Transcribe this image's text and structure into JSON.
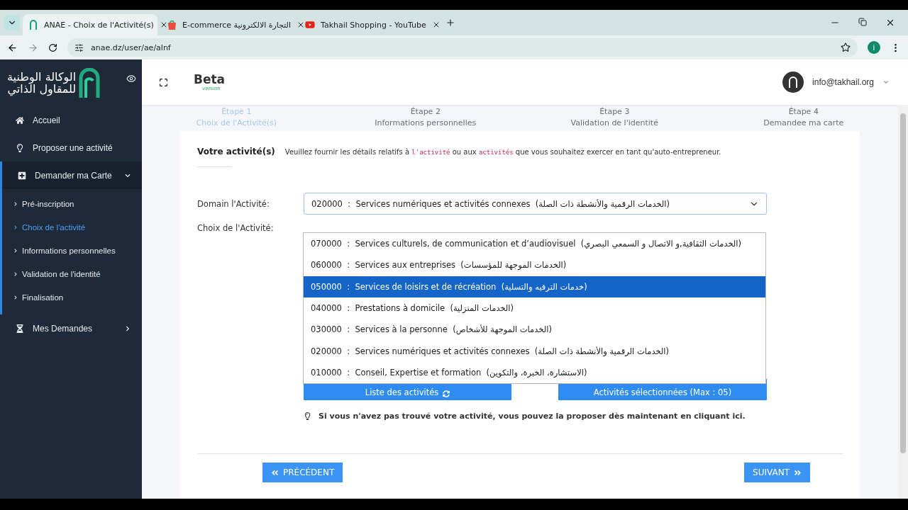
{
  "browser": {
    "tabs": [
      {
        "title": "ANAE - Choix de l'Activité(s)",
        "selected": true
      },
      {
        "title": "E-commerce التجارة الالكترونية",
        "selected": false
      },
      {
        "title": "Takhail Shopping - YouTube",
        "selected": false
      }
    ],
    "url": "anae.dz/user/ae/alnf",
    "profile": "i"
  },
  "sidebar": {
    "logo_lines": [
      "الوكالة الوطنية",
      "للمقاول الذاتي"
    ],
    "items": [
      {
        "label": "Accueil",
        "expanded": false
      },
      {
        "label": "Proposer une activité",
        "expanded": false
      },
      {
        "label": "Demander ma Carte",
        "expanded": true,
        "children": [
          {
            "label": "Pré-inscription",
            "selected": false
          },
          {
            "label": "Choix de l'activité",
            "selected": true
          },
          {
            "label": "Informations personnelles",
            "selected": false
          },
          {
            "label": "Validation de l'identité",
            "selected": false
          },
          {
            "label": "Finalisation",
            "selected": false
          }
        ]
      },
      {
        "label": "Mes Demandes",
        "expanded": false
      }
    ]
  },
  "header": {
    "brand": "Beta",
    "brand_sub": "version",
    "user": "info@takhail.org"
  },
  "steps": [
    {
      "step": "Étape 1",
      "label": "Choix de l'Activité(s)",
      "selected": true
    },
    {
      "step": "Étape 2",
      "label": "Informations personnelles",
      "selected": false
    },
    {
      "step": "Étape 3",
      "label": "Validation de l'identité",
      "selected": false
    },
    {
      "step": "Étape 4",
      "label": "Demandee ma carte",
      "selected": false
    }
  ],
  "card": {
    "title": "Votre activité(s)",
    "intro": [
      {
        "kind": "text",
        "text": "Veuillez fournir les détails relatifs à "
      },
      {
        "kind": "code",
        "text": "l'activité"
      },
      {
        "kind": "text",
        "text": " ou aux "
      },
      {
        "kind": "code",
        "text": "activités"
      },
      {
        "kind": "text",
        "text": " que vous souhaitez exercer en tant qu'auto-entrepreneur."
      }
    ],
    "domain_label": "Domain l'Activité:",
    "domain_value": "020000  :  Services numériques et activités connexes  (الخدمات الرقمية والأنشطة ذات الصلة)",
    "choice_label": "Choix de l'Activité:",
    "options": [
      {
        "label": "070000  :  Services culturels, de communication et d’audiovisuel  (الخدمات الثقافية,و الاتصال و السمعي البصري)",
        "selected": false
      },
      {
        "label": "060000  :  Services aux entreprises  (الخدمات الموجهة للمؤسسات)",
        "selected": false
      },
      {
        "label": "050000  :  Services de loisirs et de récréation  (خدمات الترفيه والتسلية)",
        "selected": true
      },
      {
        "label": "040000  :  Prestations à domicile  (الخدمات المنزلية)",
        "selected": false
      },
      {
        "label": "030000  :  Services à la personne  (الخدمات الموجهة للأشخاص)",
        "selected": false
      },
      {
        "label": "020000  :  Services numériques et activités connexes  (الخدمات الرقمية والأنشطة ذات الصلة)",
        "selected": false
      },
      {
        "label": "010000  :  Conseil, Expertise et formation  (الاستشارة، الخبرة، والتكوين)",
        "selected": false
      }
    ],
    "list_button": "Liste des activités",
    "selected_button": "Activités sélectionnées (Max : 05)",
    "hint": "Si vous n'avez pas trouvé votre activité, vous pouvez la proposer dès maintenant en cliquant ici.",
    "prev": "PRÉCÉDENT",
    "next": "SUIVANT"
  }
}
